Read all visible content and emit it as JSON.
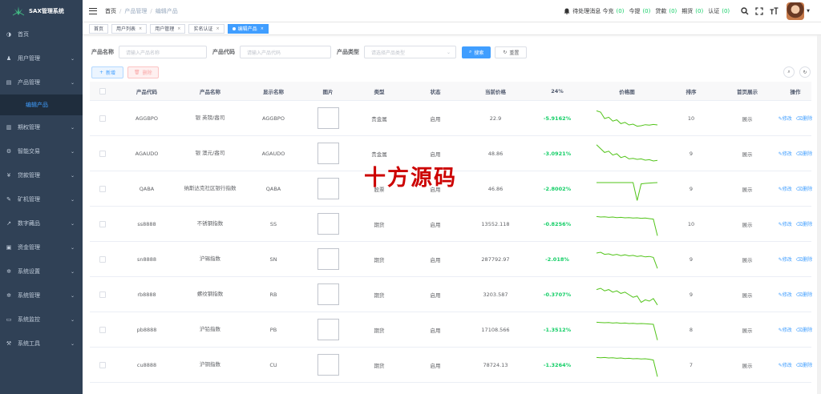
{
  "app": {
    "title": "SAX管理系统"
  },
  "sidebar": {
    "items": [
      {
        "label": "首页",
        "icon": "dashboard-icon"
      },
      {
        "label": "用户管理",
        "icon": "user-icon"
      },
      {
        "label": "产品管理",
        "icon": "document-icon"
      },
      {
        "label": "期权管理",
        "icon": "chart-icon"
      },
      {
        "label": "智能交易",
        "icon": "settings-icon"
      },
      {
        "label": "贷款管理",
        "icon": "money-icon"
      },
      {
        "label": "矿机管理",
        "icon": "edit-icon"
      },
      {
        "label": "数字藏品",
        "icon": "trend-icon"
      },
      {
        "label": "资金管理",
        "icon": "wallet-icon"
      },
      {
        "label": "系统设置",
        "icon": "gear-icon"
      },
      {
        "label": "系统管理",
        "icon": "gear-icon"
      },
      {
        "label": "系统监控",
        "icon": "monitor-icon"
      },
      {
        "label": "系统工具",
        "icon": "tool-icon"
      }
    ],
    "active_sub": "编辑产品"
  },
  "header": {
    "breadcrumb": [
      "首页",
      "产品管理",
      "编辑产品"
    ],
    "notice_label": "待处理消息 今充",
    "notice_count": "(0)",
    "withdraw_label": "今提",
    "withdraw_count": "(0)",
    "loan_label": "贷款",
    "loan_count": "(0)",
    "futures_label": "期货",
    "futures_count": "(0)",
    "auth_label": "认证",
    "auth_count": "(0)"
  },
  "tags": [
    {
      "label": "首页",
      "closable": false,
      "active": false
    },
    {
      "label": "用户列表",
      "closable": true,
      "active": false
    },
    {
      "label": "用户管理",
      "closable": true,
      "active": false
    },
    {
      "label": "实名认证",
      "closable": true,
      "active": false
    },
    {
      "label": "编辑产品",
      "closable": true,
      "active": true
    }
  ],
  "search": {
    "name_label": "产品名称",
    "name_placeholder": "请输入产品名称",
    "code_label": "产品代码",
    "code_placeholder": "请输入产品代码",
    "type_label": "产品类型",
    "type_placeholder": "请选择产品类型",
    "search_button": "搜索",
    "reset_button": "重置"
  },
  "toolbar": {
    "add_label": "新增",
    "delete_label": "删除"
  },
  "table": {
    "columns": [
      "产品代码",
      "产品名称",
      "显示名称",
      "图片",
      "类型",
      "状态",
      "当前价格",
      "24%",
      "价格图",
      "排序",
      "首页展示",
      "操作"
    ],
    "edit_label": "修改",
    "delete_label": "删除",
    "rows": [
      {
        "code": "AGGBPO",
        "name": "银 英镑/盎司",
        "display": "AGGBPO",
        "type": "贵金属",
        "status": "启用",
        "price": "22.9",
        "change": "-5.9162%",
        "sort": "10",
        "home": "展示",
        "spark": [
          0.2,
          0.25,
          0.5,
          0.45,
          0.6,
          0.55,
          0.7,
          0.65,
          0.75,
          0.72,
          0.8,
          0.78,
          0.74,
          0.76,
          0.73,
          0.75
        ]
      },
      {
        "code": "AGAUDO",
        "name": "银 澳元/盎司",
        "display": "AGAUDO",
        "type": "贵金属",
        "status": "启用",
        "price": "48.86",
        "change": "-3.0921%",
        "sort": "9",
        "home": "展示",
        "spark": [
          0.15,
          0.3,
          0.45,
          0.4,
          0.55,
          0.5,
          0.65,
          0.6,
          0.7,
          0.68,
          0.72,
          0.7,
          0.75,
          0.73,
          0.78,
          0.76
        ]
      },
      {
        "code": "QABA",
        "name": "纳斯达克社区银行指数",
        "display": "QABA",
        "type": "股票",
        "status": "启用",
        "price": "46.86",
        "change": "-2.8002%",
        "sort": "9",
        "home": "展示",
        "spark": [
          0.25,
          0.25,
          0.25,
          0.25,
          0.25,
          0.25,
          0.25,
          0.25,
          0.25,
          0.25,
          0.95,
          0.3,
          0.28,
          0.27,
          0.26,
          0.25
        ]
      },
      {
        "code": "ss8888",
        "name": "不锈钢指数",
        "display": "SS",
        "type": "期货",
        "status": "启用",
        "price": "13552.118",
        "change": "-0.8256%",
        "sort": "10",
        "home": "展示",
        "spark": [
          0.2,
          0.22,
          0.21,
          0.23,
          0.22,
          0.24,
          0.23,
          0.25,
          0.24,
          0.26,
          0.25,
          0.27,
          0.26,
          0.28,
          0.3,
          0.95
        ]
      },
      {
        "code": "sn8888",
        "name": "沪锡指数",
        "display": "SN",
        "type": "期货",
        "status": "启用",
        "price": "287792.97",
        "change": "-2.018%",
        "sort": "9",
        "home": "展示",
        "spark": [
          0.25,
          0.22,
          0.3,
          0.28,
          0.33,
          0.3,
          0.35,
          0.32,
          0.36,
          0.34,
          0.38,
          0.36,
          0.4,
          0.38,
          0.42,
          0.85
        ]
      },
      {
        "code": "rb8888",
        "name": "螺纹钢指数",
        "display": "RB",
        "type": "期货",
        "status": "启用",
        "price": "3203.587",
        "change": "-0.3707%",
        "sort": "9",
        "home": "展示",
        "spark": [
          0.3,
          0.25,
          0.35,
          0.3,
          0.4,
          0.35,
          0.45,
          0.4,
          0.5,
          0.6,
          0.55,
          0.8,
          0.7,
          0.75,
          0.65,
          0.9
        ]
      },
      {
        "code": "pb8888",
        "name": "沪铅指数",
        "display": "PB",
        "type": "期货",
        "status": "启用",
        "price": "17108.566",
        "change": "-1.3512%",
        "sort": "8",
        "home": "展示",
        "spark": [
          0.2,
          0.21,
          0.22,
          0.21,
          0.23,
          0.22,
          0.24,
          0.23,
          0.25,
          0.24,
          0.26,
          0.25,
          0.26,
          0.27,
          0.28,
          0.9
        ]
      },
      {
        "code": "cu8888",
        "name": "沪铜指数",
        "display": "CU",
        "type": "期货",
        "status": "启用",
        "price": "78724.13",
        "change": "-1.3264%",
        "sort": "7",
        "home": "展示",
        "spark": [
          0.2,
          0.21,
          0.2,
          0.22,
          0.21,
          0.23,
          0.22,
          0.24,
          0.23,
          0.25,
          0.24,
          0.26,
          0.25,
          0.27,
          0.3,
          0.95
        ]
      }
    ]
  },
  "watermark": "十方源码"
}
